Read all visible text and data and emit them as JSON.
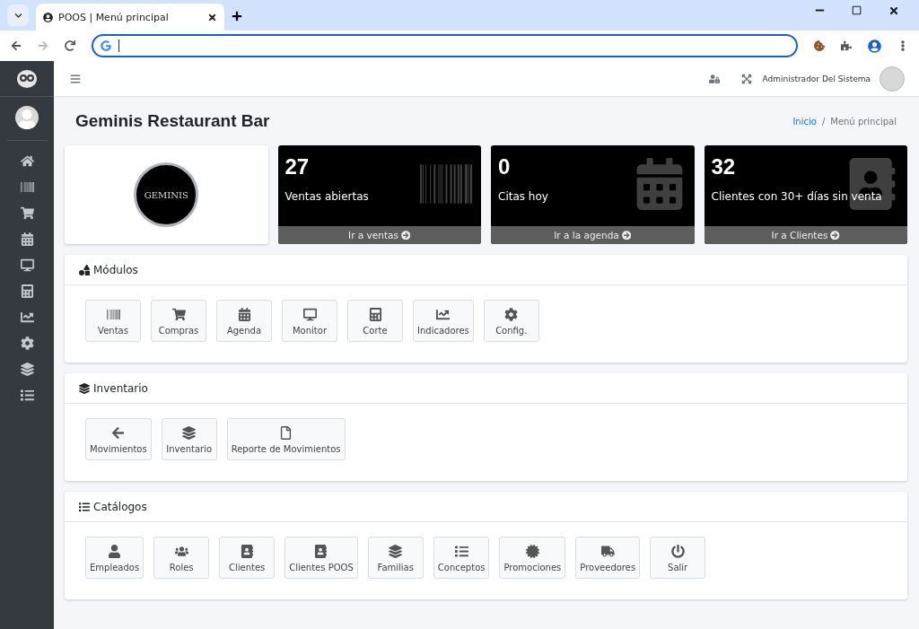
{
  "browser": {
    "tab_title": "POOS | Menú principal"
  },
  "topbar": {
    "user_name": "Administrador Del Sistema"
  },
  "page": {
    "title": "Geminis Restaurant Bar",
    "breadcrumb": [
      {
        "label": "Inicio",
        "kind": "link"
      },
      {
        "label": "/",
        "kind": "separator"
      },
      {
        "label": "Menú principal",
        "kind": "current"
      }
    ]
  },
  "logo_card": {
    "logo_text": "GEMINIS"
  },
  "stats": [
    {
      "value": "27",
      "label": "Ventas abiertas",
      "link": "Ir a ventas"
    },
    {
      "value": "0",
      "label": "Citas hoy",
      "link": "Ir a la agenda"
    },
    {
      "value": "32",
      "label": "Clientes con 30+ días sin venta",
      "link": "Ir a Clientes"
    }
  ],
  "sections": [
    {
      "title": "Módulos",
      "items": [
        "Ventas",
        "Compras",
        "Agenda",
        "Monitor",
        "Corte",
        "Indicadores",
        "Config."
      ]
    },
    {
      "title": "Inventario",
      "items": [
        "Movimientos",
        "Inventario",
        "Reporte de Movimientos"
      ]
    },
    {
      "title": "Catálogos",
      "items": [
        "Empleados",
        "Roles",
        "Clientes",
        "Clientes POOS",
        "Familias",
        "Conceptos",
        "Promociones",
        "Proveedores",
        "Salir"
      ]
    }
  ]
}
